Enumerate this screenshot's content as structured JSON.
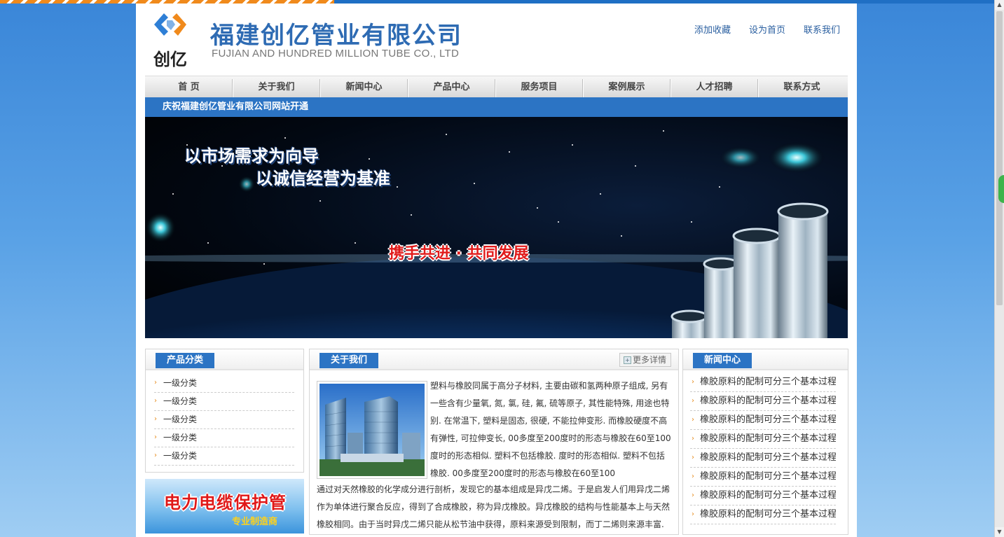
{
  "header": {
    "logo_text": "创亿",
    "company_name": "福建创亿管业有限公司",
    "company_name_en": "FUJIAN AND HUNDRED MILLION TUBE CO., LTD",
    "links": [
      "添加收藏",
      "设为首页",
      "联系我们"
    ]
  },
  "nav": {
    "items": [
      "首  页",
      "关于我们",
      "新闻中心",
      "产品中心",
      "服务项目",
      "案例展示",
      "人才招聘",
      "联系方式"
    ]
  },
  "news_bar": {
    "text": "庆祝福建创亿管业有限公司网站开通"
  },
  "banner": {
    "slogan_1": "以市场需求为向导",
    "slogan_2": "以诚信经营为基准",
    "slogan_3": "携手共进 · 共同发展"
  },
  "product_categories": {
    "title": "产品分类",
    "items": [
      "一级分类",
      "一级分类",
      "一级分类",
      "一级分类",
      "一级分类"
    ]
  },
  "promo": {
    "title": "电力电缆保护管",
    "subtitle": "专业制造商"
  },
  "about": {
    "title": "关于我们",
    "more_label": "更多详情",
    "paragraph_1": "塑料与橡胶同属于高分子材料, 主要由碳和氢两种原子组成, 另有一些含有少量氧, 氮, 氯, 硅, 氟, 硫等原子, 其性能特殊, 用途也特别. 在常温下, 塑料是固态, 很硬, 不能拉伸变形. 而橡胶硬度不高有弹性, 可拉伸变长, 00多度至200度时的形态与橡胶在60至100度时的形态相似. 塑料不包括橡胶.  度时的形态相似. 塑料不包括橡胶. 00多度至200度时的形态与橡胶在60至100",
    "paragraph_2": "通过对天然橡胶的化学成分进行剖析，发现它的基本组成是异戊二烯。于是启发人们用异戊二烯作为单体进行聚合反应，得到了合成橡胶，称为异戊橡胶。异戊橡胶的结构与性能基本上与天然橡胶相同。由于当时异戊二烯只能从松节油中获得，原料来源受到限制，而丁二烯则来源丰富."
  },
  "news_center": {
    "title": "新闻中心",
    "items": [
      "橡胶原料的配制可分三个基本过程",
      "橡胶原料的配制可分三个基本过程",
      "橡胶原料的配制可分三个基本过程",
      "橡胶原料的配制可分三个基本过程",
      "橡胶原料的配制可分三个基本过程",
      "橡胶原料的配制可分三个基本过程",
      "橡胶原料的配制可分三个基本过程",
      "橡胶原料的配制可分三个基本过程"
    ]
  },
  "colors": {
    "brand_blue": "#2c74c4",
    "accent_orange": "#f08a1c",
    "promo_red": "#e01818"
  }
}
